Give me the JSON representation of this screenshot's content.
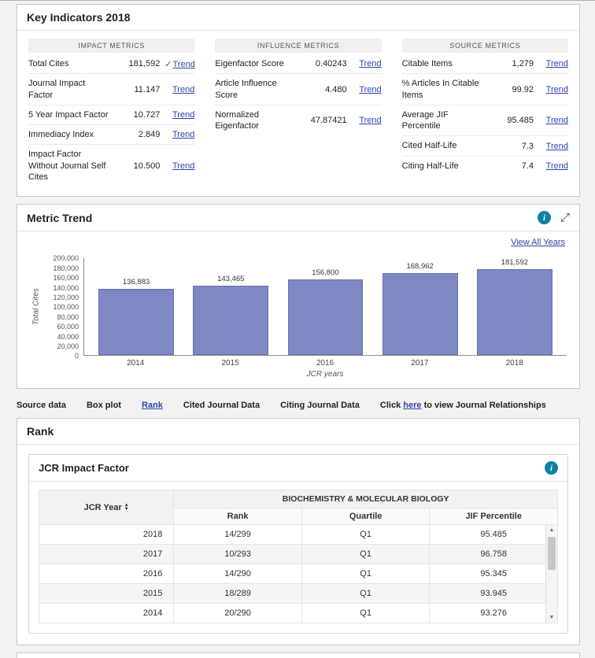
{
  "colors": {
    "link": "#2c44aa",
    "info_icon": "#0e7fa5",
    "bar_fill": "#8088c3",
    "bar_border": "#6670b0",
    "check": "#336b2a"
  },
  "icons": {
    "info": "i",
    "expand": "⤢",
    "check": "✓",
    "sort_up": "▲",
    "sort_down": "▼",
    "scroll_up": "▲",
    "scroll_down": "▼"
  },
  "key_indicators": {
    "title": "Key Indicators 2018",
    "columns": [
      {
        "header": "IMPACT METRICS",
        "rows": [
          {
            "label": "Total Cites",
            "value": "181,592",
            "link": "Trend",
            "checked": true
          },
          {
            "label": "Journal Impact Factor",
            "value": "11.147",
            "link": "Trend",
            "checked": false
          },
          {
            "label": "5 Year Impact Factor",
            "value": "10.727",
            "link": "Trend",
            "checked": false
          },
          {
            "label": "Immediacy Index",
            "value": "2.849",
            "link": "Trend",
            "checked": false
          },
          {
            "label": "Impact Factor Without Journal Self Cites",
            "value": "10.500",
            "link": "Trend",
            "checked": false
          }
        ]
      },
      {
        "header": "INFLUENCE METRICS",
        "rows": [
          {
            "label": "Eigenfactor Score",
            "value": "0.40243",
            "link": "Trend",
            "checked": false
          },
          {
            "label": "Article Influence Score",
            "value": "4.480",
            "link": "Trend",
            "checked": false
          },
          {
            "label": "Normalized Eigenfactor",
            "value": "47.87421",
            "link": "Trend",
            "checked": false
          }
        ]
      },
      {
        "header": "SOURCE METRICS",
        "rows": [
          {
            "label": "Citable Items",
            "value": "1,279",
            "link": "Trend",
            "checked": false
          },
          {
            "label": "% Articles In Citable Items",
            "value": "99.92",
            "link": "Trend",
            "checked": false
          },
          {
            "label": "Average JIF Percentile",
            "value": "95.485",
            "link": "Trend",
            "checked": false
          },
          {
            "label": "Cited Half-Life",
            "value": "7.3",
            "link": "Trend",
            "checked": false
          },
          {
            "label": "Citing Half-Life",
            "value": "7.4",
            "link": "Trend",
            "checked": false
          }
        ]
      }
    ]
  },
  "metric_trend": {
    "title": "Metric Trend",
    "view_all_label": "View All Years"
  },
  "chart_data": {
    "type": "bar",
    "title": "Metric Trend",
    "categories": [
      "2014",
      "2015",
      "2016",
      "2017",
      "2018"
    ],
    "values": [
      136883,
      143465,
      156800,
      168962,
      181592
    ],
    "value_labels": [
      "136,883",
      "143,465",
      "156,800",
      "168,962",
      "181,592"
    ],
    "xlabel": "JCR years",
    "ylabel": "Total Cites",
    "ylim": [
      0,
      200000
    ],
    "ytick_step": 20000,
    "yticks": [
      "0",
      "20,000",
      "40,000",
      "60,000",
      "80,000",
      "100,000",
      "120,000",
      "140,000",
      "160,000",
      "180,000",
      "200,000"
    ],
    "grid": false,
    "legend": false
  },
  "tabs": {
    "items": [
      {
        "label": "Source data",
        "active": false
      },
      {
        "label": "Box plot",
        "active": false
      },
      {
        "label": "Rank",
        "active": true
      },
      {
        "label": "Cited Journal Data",
        "active": false
      },
      {
        "label": "Citing Journal Data",
        "active": false
      }
    ],
    "relationship_text_before": "Click ",
    "relationship_link": "here",
    "relationship_text_after": " to view Journal Relationships"
  },
  "rank": {
    "title": "Rank",
    "subpanel_title": "JCR Impact Factor",
    "table": {
      "year_header": "JCR Year",
      "group_header": "BIOCHEMISTRY & MOLECULAR BIOLOGY",
      "columns": [
        "Rank",
        "Quartile",
        "JIF Percentile"
      ],
      "rows": [
        {
          "year": "2018",
          "rank": "14/299",
          "quartile": "Q1",
          "jif_percentile": "95.485"
        },
        {
          "year": "2017",
          "rank": "10/293",
          "quartile": "Q1",
          "jif_percentile": "96.758"
        },
        {
          "year": "2016",
          "rank": "14/290",
          "quartile": "Q1",
          "jif_percentile": "95.345"
        },
        {
          "year": "2015",
          "rank": "18/289",
          "quartile": "Q1",
          "jif_percentile": "93.945"
        },
        {
          "year": "2014",
          "rank": "20/290",
          "quartile": "Q1",
          "jif_percentile": "93.276"
        }
      ]
    }
  }
}
